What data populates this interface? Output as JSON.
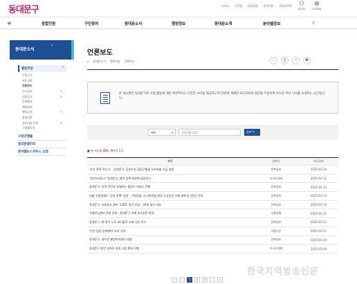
{
  "header": {
    "logo": "동대문구",
    "util_links": [
      "누리소",
      "구민참",
      "분류찾음",
      "원격서비",
      "주요사이트"
    ],
    "util_icons": [
      {
        "icon": "user-icon",
        "label": "로그인"
      },
      {
        "icon": "globe-icon",
        "label": "GLOBAL"
      }
    ]
  },
  "gnb": {
    "items": [
      "종합민원",
      "구민참여",
      "동대문소식",
      "행정정보",
      "동대문소개",
      "분야별정보"
    ]
  },
  "lnb": {
    "title": "동대문소식",
    "section": "열린마당",
    "section_toggle": "^",
    "subs": [
      {
        "label": "구정소식",
        "arrow": ""
      },
      {
        "label": "보도자료",
        "arrow": ""
      },
      {
        "label": "언론보도",
        "arrow": "",
        "active": true
      },
      {
        "label": "고시공고",
        "arrow": "+"
      },
      {
        "label": "입찰공고",
        "arrow": "+"
      },
      {
        "label": "문화행사",
        "arrow": ""
      },
      {
        "label": "채용정보",
        "arrow": ""
      },
      {
        "label": "행정공개",
        "arrow": "+"
      },
      {
        "label": "통계자료",
        "arrow": ""
      },
      {
        "label": "공모사업 안내",
        "arrow": "+"
      },
      {
        "label": "구정홍보실",
        "arrow": ""
      }
    ],
    "mains": [
      "구정간행물",
      "동대문갤러리",
      "분야별뉴스서비스 신청"
    ]
  },
  "content": {
    "title": "언론보도",
    "breadcrumb": [
      "⌂",
      "동대문소식",
      "열린마당",
      "언론보도"
    ],
    "tools": [
      "☆",
      "⎙",
      "↗",
      "🖶"
    ],
    "info": "본 게시판은 동대문구의 구정 활동에 대한 객관적이고 다양한 사각을 제공하고자 언론에 게재된 보도자료의 원문을 수집하여 보도된 주요 기사를 소개하는 공간입니다.",
    "search": {
      "select": "제목",
      "placeholder": "검색어를 입력",
      "button": "검색 🔍"
    },
    "count_prefix": "총 게시물",
    "count_value": "201",
    "count_page": "페이지 1/3",
    "table": {
      "headers": [
        "제목",
        "언론사",
        "보도일자"
      ],
      "rows": [
        [
          "'토지 면적 먹는다'…동대문구, 공원조성 합동구별을 오로지침 지금 개정",
          "문화일보",
          "2025-03-14"
        ],
        [
          "'청년도약도시' 동대문구, 청년 정책 지원에 앞장선다",
          "아시아경제",
          "2025-03-12"
        ],
        [
          "동대문구, 지역 주민과 함께하는 봄맞이 대청소 진행",
          "문화일보",
          "2025-03-13"
        ],
        [
          "서울 구청장들도 '공정 정책' 동참…구청장들, 도시정비법 개정 소상공인 규제 완화 등 22건 건의",
          "문화일보",
          "2025-03-13"
        ],
        [
          "동대문구, 자원봉사 캠프 '1365' 정기 모집…30일 접수 마감",
          "문화일보",
          "2025-03-13"
        ],
        [
          "치매안심센터 운영 강화…동대문구 치매 조기검진 확대",
          "서울경제",
          "2025-03-11"
        ],
        [
          "동대문구, 봄 맞이 노후 보도블럭 교체 사업 착수",
          "문화일보",
          "2025-03-11"
        ],
        [
          "'안전 점검 강화해야' 지속 지적",
          "서울신문",
          "2025-03-11"
        ],
        [
          "동대문구, 새로운 행정복지센터 개청",
          "문화일보",
          "2025-03-10"
        ],
        [
          "동대문구 청년 일자리 지원 사업 확대 시행",
          "아시아경제",
          "2025-03-09"
        ]
      ]
    },
    "pager": [
      "«",
      "‹",
      "1",
      "2",
      "3",
      "›",
      "»"
    ],
    "pager_active": "1"
  },
  "watermark": "한국지역방송신문"
}
